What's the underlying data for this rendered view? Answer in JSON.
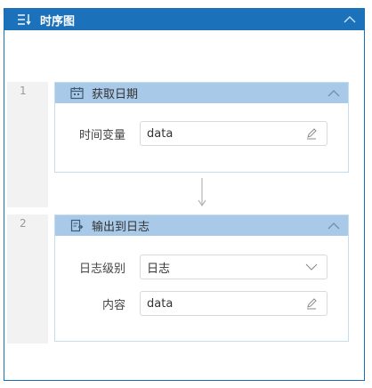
{
  "window": {
    "title": "时序图"
  },
  "steps": [
    {
      "number": "1",
      "title": "获取日期",
      "icon": "calendar-icon",
      "fields": [
        {
          "label": "时间变量",
          "value": "data",
          "control": "edit"
        }
      ]
    },
    {
      "number": "2",
      "title": "输出到日志",
      "icon": "log-output-icon",
      "fields": [
        {
          "label": "日志级别",
          "value": "日志",
          "control": "dropdown"
        },
        {
          "label": "内容",
          "value": "data",
          "control": "edit"
        }
      ]
    }
  ],
  "colors": {
    "title_bar": "#1c72ba",
    "card_header": "#a9c9e8",
    "card_border": "#c5dcef",
    "step_strip": "#f2f2f2"
  }
}
